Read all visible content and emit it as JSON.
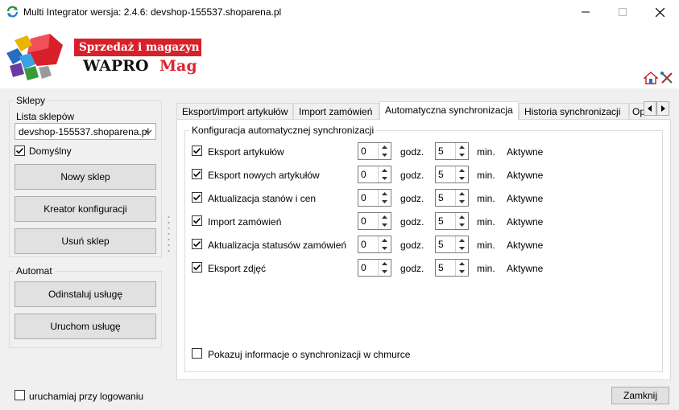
{
  "window": {
    "title": "Multi Integrator wersja: 2.4.6: devshop-155537.shoparena.pl"
  },
  "header": {
    "tagline": "Sprzedaż i magazyn",
    "brand_a": "WAPRO",
    "brand_b": "Mag",
    "icons": [
      "home-icon",
      "tools-icon"
    ]
  },
  "left": {
    "shops_group": "Sklepy",
    "shops_list_label": "Lista sklepów",
    "shop_selected": "devshop-155537.shoparena.pl",
    "default_label": "Domyślny",
    "default_checked": true,
    "new_shop_button": "Nowy sklep",
    "wizard_button": "Kreator konfiguracji",
    "delete_shop_button": "Usuń sklep",
    "automat_group": "Automat",
    "uninstall_button": "Odinstaluj usługę",
    "start_button": "Uruchom usługę",
    "autostart_label": "uruchamiaj przy logowaniu",
    "autostart_checked": false
  },
  "tabs": [
    {
      "label": "Eksport/import artykułów"
    },
    {
      "label": "Import zamówień"
    },
    {
      "label": "Automatyczna synchronizacja"
    },
    {
      "label": "Historia synchronizacji"
    },
    {
      "label": "Op"
    }
  ],
  "sync": {
    "group_title": "Konfiguracja automatycznej synchronizacji",
    "hours_unit": "godz.",
    "minutes_unit": "min.",
    "rows": [
      {
        "label": "Eksport artykułów",
        "checked": true,
        "hours": "0",
        "minutes": "5",
        "status": "Aktywne"
      },
      {
        "label": "Eksport nowych artykułów",
        "checked": true,
        "hours": "0",
        "minutes": "5",
        "status": "Aktywne"
      },
      {
        "label": "Aktualizacja stanów i cen",
        "checked": true,
        "hours": "0",
        "minutes": "5",
        "status": "Aktywne"
      },
      {
        "label": "Import zamówień",
        "checked": true,
        "hours": "0",
        "minutes": "5",
        "status": "Aktywne"
      },
      {
        "label": "Aktualizacja statusów zamówień",
        "checked": true,
        "hours": "0",
        "minutes": "5",
        "status": "Aktywne"
      },
      {
        "label": "Eksport zdjęć",
        "checked": true,
        "hours": "0",
        "minutes": "5",
        "status": "Aktywne"
      }
    ],
    "cloud_info_label": "Pokazuj informacje o synchronizacji w chmurce",
    "cloud_info_checked": false
  },
  "footer": {
    "close_button": "Zamknij"
  }
}
